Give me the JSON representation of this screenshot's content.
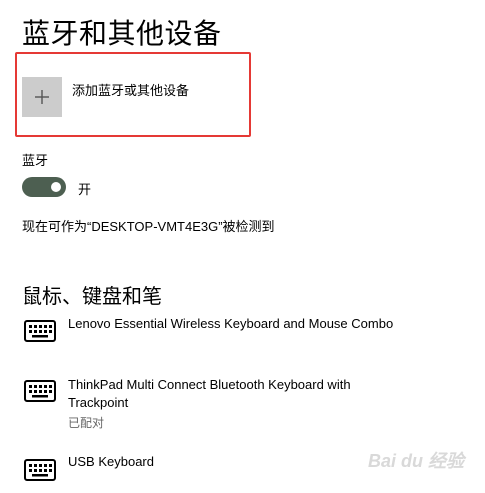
{
  "header": {
    "title": "蓝牙和其他设备"
  },
  "add_device": {
    "label": "添加蓝牙或其他设备",
    "icon": "plus-icon"
  },
  "bluetooth": {
    "section_label": "蓝牙",
    "toggle_state": "开",
    "toggle_on": true,
    "discoverable_text": "现在可作为“DESKTOP-VMT4E3G”被检测到"
  },
  "devices_section": {
    "title": "鼠标、键盘和笔",
    "items": [
      {
        "name": "Lenovo Essential Wireless Keyboard and Mouse Combo",
        "status": "",
        "icon": "keyboard-icon"
      },
      {
        "name": "ThinkPad Multi Connect Bluetooth Keyboard with Trackpoint",
        "status": "已配对",
        "icon": "keyboard-icon"
      },
      {
        "name": "USB Keyboard",
        "status": "",
        "icon": "keyboard-icon"
      }
    ]
  },
  "colors": {
    "highlight": "#e53935",
    "toggle_on": "#4d5f51",
    "tile": "#cccccc"
  },
  "watermark": {
    "text": "Bai du 经验"
  }
}
